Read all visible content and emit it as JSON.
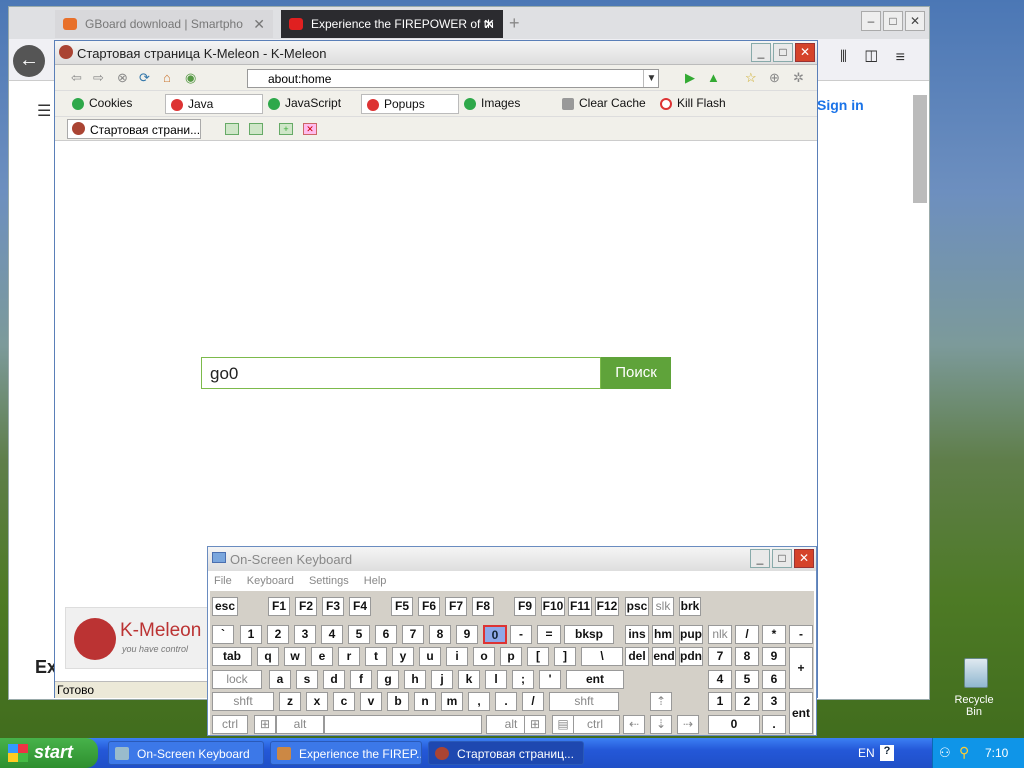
{
  "firefox": {
    "tabs": [
      {
        "label": "GBoard download | Smartpho"
      },
      {
        "label": "Experience the FIREPOWER of th"
      }
    ],
    "sign_in": "Sign in",
    "bottom_text": "Ex"
  },
  "kmeleon": {
    "title": "Стартовая страница K-Meleon - K-Meleon",
    "url": "about:home",
    "privacy": [
      {
        "label": "Cookies",
        "color": "#2ea84a"
      },
      {
        "label": "Java",
        "color": "#d33"
      },
      {
        "label": "JavaScript",
        "color": "#2ea84a"
      },
      {
        "label": "Popups",
        "color": "#d33"
      },
      {
        "label": "Images",
        "color": "#2ea84a"
      },
      {
        "label": "Clear Cache",
        "color": "#888"
      },
      {
        "label": "Kill Flash",
        "color": "#d33"
      }
    ],
    "tab_label": "Стартовая страни...",
    "search_value": "go0",
    "search_button": "Поиск",
    "logo_text": "K-Meleon",
    "logo_sub": "you have control",
    "status": "Готово"
  },
  "osk": {
    "title": "On-Screen Keyboard",
    "menu": [
      "File",
      "Keyboard",
      "Settings",
      "Help"
    ],
    "rows": [
      [
        "esc",
        "F1",
        "F2",
        "F3",
        "F4",
        "F5",
        "F6",
        "F7",
        "F8",
        "F9",
        "F10",
        "F11",
        "F12",
        "psc",
        "slk",
        "brk"
      ],
      [
        "`",
        "1",
        "2",
        "3",
        "4",
        "5",
        "6",
        "7",
        "8",
        "9",
        "0",
        "-",
        "=",
        "bksp",
        "ins",
        "hm",
        "pup",
        "nlk",
        "/",
        "*",
        "-"
      ],
      [
        "tab",
        "q",
        "w",
        "e",
        "r",
        "t",
        "y",
        "u",
        "i",
        "o",
        "p",
        "[",
        "]",
        "\\",
        "del",
        "end",
        "pdn",
        "7",
        "8",
        "9",
        "+"
      ],
      [
        "lock",
        "a",
        "s",
        "d",
        "f",
        "g",
        "h",
        "j",
        "k",
        "l",
        ";",
        "'",
        "ent",
        "4",
        "5",
        "6"
      ],
      [
        "shft",
        "z",
        "x",
        "c",
        "v",
        "b",
        "n",
        "m",
        ",",
        ".",
        "/",
        "shft",
        "1",
        "2",
        "3",
        "ent"
      ],
      [
        "ctrl",
        "alt",
        "alt",
        "ctrl",
        "0",
        "."
      ]
    ]
  },
  "taskbar": {
    "start": "start",
    "items": [
      "On-Screen Keyboard",
      "Experience the FIREP...",
      "Стартовая страниц..."
    ],
    "lang": "EN",
    "clock": "7:10"
  },
  "desktop": {
    "recycle_bin": "Recycle Bin"
  }
}
